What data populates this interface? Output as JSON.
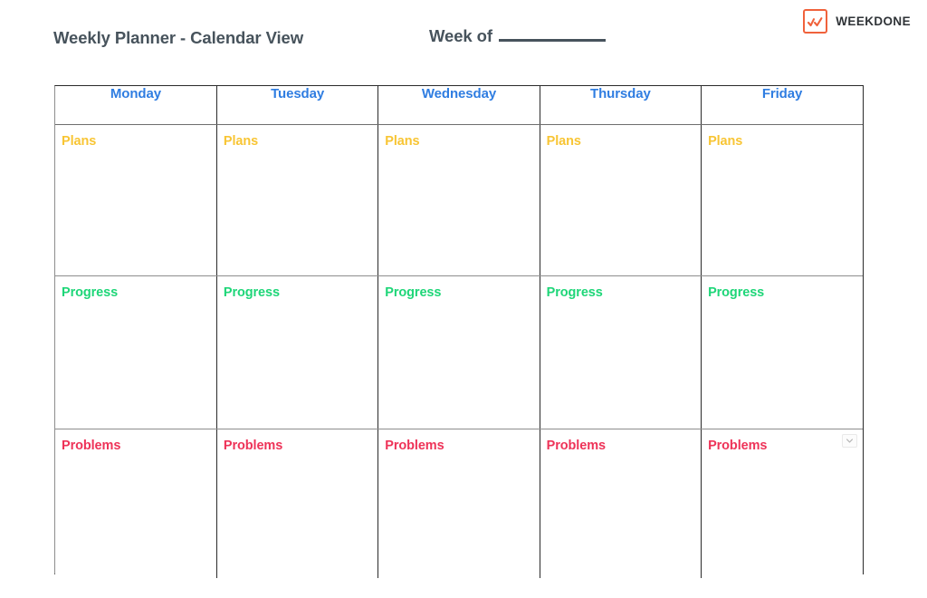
{
  "document": {
    "title": "Weekly Planner - Calendar View",
    "week_of_label": "Week of",
    "week_of_value": ""
  },
  "brand": {
    "name": "WEEKDONE",
    "mark_icon": "zigzag-chart-icon",
    "mark_color": "#f0623c",
    "name_color": "#2f3337"
  },
  "colors": {
    "title": "#47535c",
    "day_header": "#2f7de1",
    "plans": "#f8c534",
    "progress": "#1ed678",
    "problems": "#ee3358",
    "outer_border": "#2a2a2a",
    "inner_border": "#8d8d8d",
    "background": "#ffffff"
  },
  "planner": {
    "days": [
      {
        "label": "Monday"
      },
      {
        "label": "Tuesday"
      },
      {
        "label": "Wednesday"
      },
      {
        "label": "Thursday"
      },
      {
        "label": "Friday"
      }
    ],
    "sections": [
      {
        "key": "plans",
        "label": "Plans",
        "color": "#f8c534",
        "entries": [
          "",
          "",
          "",
          "",
          ""
        ]
      },
      {
        "key": "progress",
        "label": "Progress",
        "color": "#1ed678",
        "entries": [
          "",
          "",
          "",
          "",
          ""
        ]
      },
      {
        "key": "problems",
        "label": "Problems",
        "color": "#ee3358",
        "entries": [
          "",
          "",
          "",
          "",
          ""
        ]
      }
    ]
  },
  "cell_menu": {
    "icon": "chevron-down-icon"
  }
}
